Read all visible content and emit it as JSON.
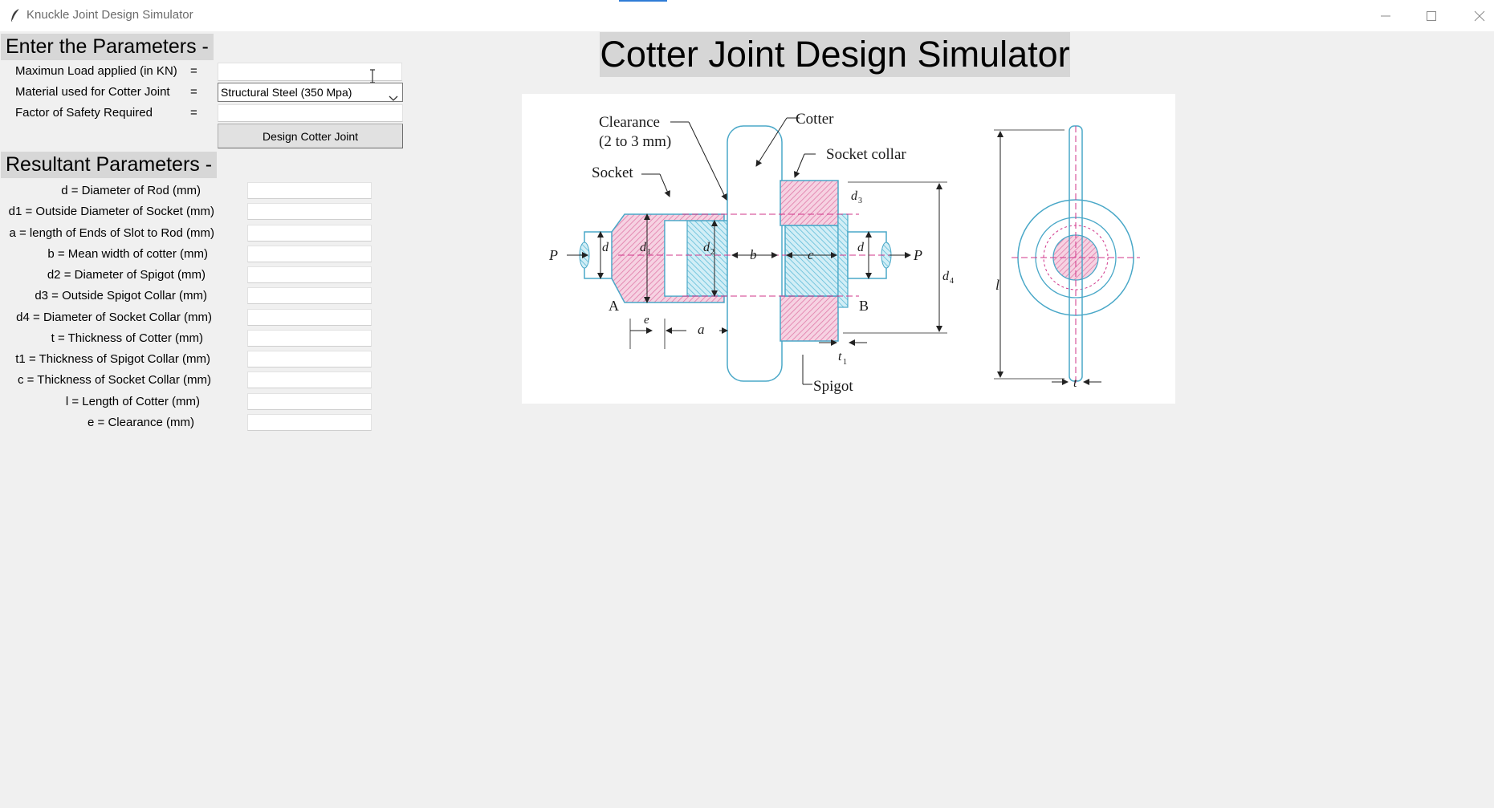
{
  "window": {
    "title": "Knuckle Joint Design Simulator"
  },
  "input_section": {
    "heading": "Enter the Parameters -",
    "fields": [
      {
        "label": "Maximun Load applied (in KN)",
        "equals": "=",
        "value": ""
      },
      {
        "label": "Material used for Cotter Joint",
        "equals": "=",
        "value": "Structural Steel (350 Mpa)"
      },
      {
        "label": "Factor of Safety Required",
        "equals": "=",
        "value": ""
      }
    ],
    "design_button_label": "Design Cotter Joint"
  },
  "result_section": {
    "heading": "Resultant Parameters -",
    "rows": [
      {
        "label": "d = Diameter of Rod (mm)",
        "value": ""
      },
      {
        "label": "d1 = Outside Diameter of Socket (mm)",
        "value": ""
      },
      {
        "label": "a = length of Ends of Slot to Rod (mm)",
        "value": ""
      },
      {
        "label": "b = Mean width of cotter (mm)",
        "value": ""
      },
      {
        "label": "d2 = Diameter of Spigot (mm)",
        "value": ""
      },
      {
        "label": "d3 = Outside Spigot Collar (mm)",
        "value": ""
      },
      {
        "label": "d4 = Diameter of Socket Collar (mm)",
        "value": ""
      },
      {
        "label": "t = Thickness of Cotter (mm)",
        "value": ""
      },
      {
        "label": "t1 = Thickness of Spigot Collar  (mm)",
        "value": ""
      },
      {
        "label": "c = Thickness of Socket Collar (mm)",
        "value": ""
      },
      {
        "label": "l = Length of Cotter (mm)",
        "value": ""
      },
      {
        "label": "e = Clearance  (mm)",
        "value": ""
      }
    ]
  },
  "main_title": "Cotter Joint Design Simulator",
  "diagram": {
    "labels": {
      "clearance": "Clearance",
      "clearance_range": "(2 to 3 mm)",
      "socket": "Socket",
      "cotter": "Cotter",
      "socket_collar": "Socket collar",
      "spigot": "Spigot",
      "p": "P",
      "a_point": "A",
      "b_point": "B",
      "d": "d",
      "d1": "d",
      "d1_sub": "1",
      "d2": "d",
      "d2_sub": "2",
      "d3": "d",
      "d3_sub": "3",
      "d4": "d",
      "d4_sub": "4",
      "b_dim": "b",
      "c_dim": "c",
      "a_dim": "a",
      "e_dim": "e",
      "t1": "t",
      "t1_sub": "1",
      "l_dim": "l",
      "t_dim": "t"
    }
  },
  "colors": {
    "pink_hatch": "#e8a0c0",
    "blue_hatch": "#8fd0e4",
    "outline_blue": "#4aa8c8",
    "center_line": "#d0358a",
    "window_bg": "#f0f0f0"
  }
}
